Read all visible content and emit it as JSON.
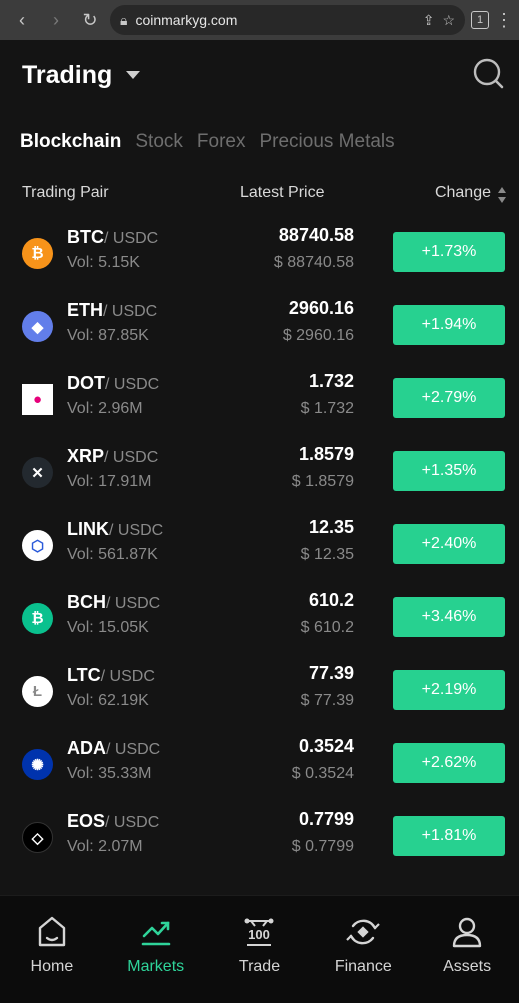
{
  "browser": {
    "url": "coinmarkyg.com",
    "tab_count": "1"
  },
  "header": {
    "title": "Trading"
  },
  "tabs": [
    {
      "label": "Blockchain",
      "active": true
    },
    {
      "label": "Stock",
      "active": false
    },
    {
      "label": "Forex",
      "active": false
    },
    {
      "label": "Precious Metals",
      "active": false
    }
  ],
  "table": {
    "col_pair": "Trading Pair",
    "col_price": "Latest Price",
    "col_change": "Change",
    "rows": [
      {
        "base": "BTC",
        "quote": "/ USDC",
        "vol": "Vol: 5.15K",
        "price": "88740.58",
        "usd": "$ 88740.58",
        "change": "+1.73%",
        "icon": "btc-icon",
        "color": "#f7931a",
        "glyph": "₿"
      },
      {
        "base": "ETH",
        "quote": "/ USDC",
        "vol": "Vol: 87.85K",
        "price": "2960.16",
        "usd": "$ 2960.16",
        "change": "+1.94%",
        "icon": "eth-icon",
        "color": "#627eea",
        "glyph": "◆"
      },
      {
        "base": "DOT",
        "quote": "/ USDC",
        "vol": "Vol: 2.96M",
        "price": "1.732",
        "usd": "$ 1.732",
        "change": "+2.79%",
        "icon": "dot-icon",
        "color": "#ffffff",
        "glyph": "●"
      },
      {
        "base": "XRP",
        "quote": "/ USDC",
        "vol": "Vol: 17.91M",
        "price": "1.8579",
        "usd": "$ 1.8579",
        "change": "+1.35%",
        "icon": "xrp-icon",
        "color": "#23292f",
        "glyph": "✕"
      },
      {
        "base": "LINK",
        "quote": "/ USDC",
        "vol": "Vol: 561.87K",
        "price": "12.35",
        "usd": "$ 12.35",
        "change": "+2.40%",
        "icon": "link-icon",
        "color": "#ffffff",
        "glyph": "⬡"
      },
      {
        "base": "BCH",
        "quote": "/ USDC",
        "vol": "Vol: 15.05K",
        "price": "610.2",
        "usd": "$ 610.2",
        "change": "+3.46%",
        "icon": "bch-icon",
        "color": "#0ac18e",
        "glyph": "₿"
      },
      {
        "base": "LTC",
        "quote": "/ USDC",
        "vol": "Vol: 62.19K",
        "price": "77.39",
        "usd": "$ 77.39",
        "change": "+2.19%",
        "icon": "ltc-icon",
        "color": "#ffffff",
        "glyph": "Ł"
      },
      {
        "base": "ADA",
        "quote": "/ USDC",
        "vol": "Vol: 35.33M",
        "price": "0.3524",
        "usd": "$ 0.3524",
        "change": "+2.62%",
        "icon": "ada-icon",
        "color": "#0033ad",
        "glyph": "✺"
      },
      {
        "base": "EOS",
        "quote": "/ USDC",
        "vol": "Vol: 2.07M",
        "price": "0.7799",
        "usd": "$ 0.7799",
        "change": "+1.81%",
        "icon": "eos-icon",
        "color": "#000000",
        "glyph": "◇"
      }
    ]
  },
  "nav": [
    {
      "label": "Home",
      "icon": "home-icon",
      "active": false
    },
    {
      "label": "Markets",
      "icon": "markets-icon",
      "active": true
    },
    {
      "label": "Trade",
      "icon": "trade-icon",
      "active": false,
      "badge": "100"
    },
    {
      "label": "Finance",
      "icon": "finance-icon",
      "active": false
    },
    {
      "label": "Assets",
      "icon": "assets-icon",
      "active": false
    }
  ],
  "colors": {
    "background": "#141414",
    "up": "#27d190",
    "active_nav": "#2fd49a"
  }
}
